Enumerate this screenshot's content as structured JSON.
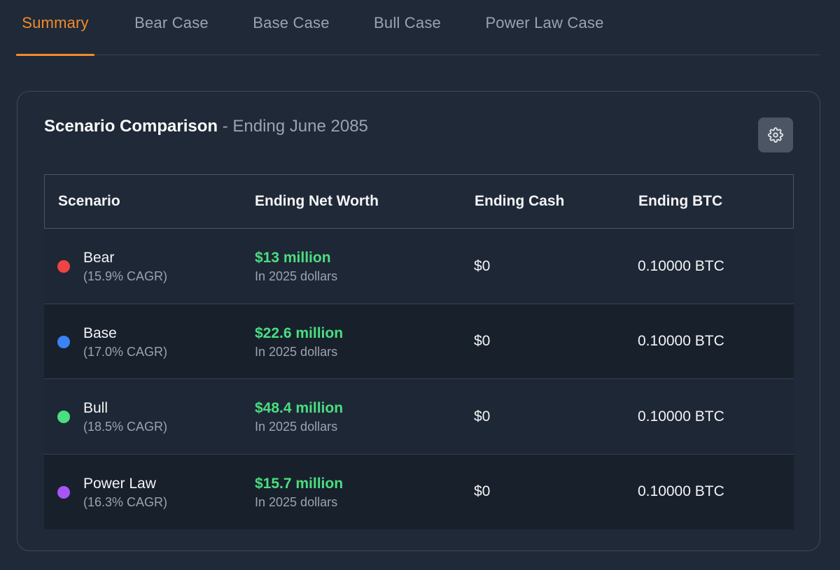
{
  "tabs": [
    {
      "label": "Summary",
      "active": true
    },
    {
      "label": "Bear Case",
      "active": false
    },
    {
      "label": "Base Case",
      "active": false
    },
    {
      "label": "Bull Case",
      "active": false
    },
    {
      "label": "Power Law Case",
      "active": false
    }
  ],
  "card": {
    "title": "Scenario Comparison",
    "separator": " - ",
    "subtitle": "Ending June 2085",
    "settings_icon": "gear-icon"
  },
  "table": {
    "headers": {
      "scenario": "Scenario",
      "net_worth": "Ending Net Worth",
      "cash": "Ending Cash",
      "btc": "Ending BTC"
    },
    "rows": [
      {
        "name": "Bear",
        "cagr": "(15.9% CAGR)",
        "color": "#ef4444",
        "net_worth": "$13 million",
        "net_worth_note": "In 2025 dollars",
        "cash": "$0",
        "btc": "0.10000 BTC"
      },
      {
        "name": "Base",
        "cagr": "(17.0% CAGR)",
        "color": "#3b82f6",
        "net_worth": "$22.6 million",
        "net_worth_note": "In 2025 dollars",
        "cash": "$0",
        "btc": "0.10000 BTC"
      },
      {
        "name": "Bull",
        "cagr": "(18.5% CAGR)",
        "color": "#4ade80",
        "net_worth": "$48.4 million",
        "net_worth_note": "In 2025 dollars",
        "cash": "$0",
        "btc": "0.10000 BTC"
      },
      {
        "name": "Power Law",
        "cagr": "(16.3% CAGR)",
        "color": "#a855f7",
        "net_worth": "$15.7 million",
        "net_worth_note": "In 2025 dollars",
        "cash": "$0",
        "btc": "0.10000 BTC"
      }
    ]
  },
  "colors": {
    "accent": "#f28b2e",
    "positive": "#4ade80",
    "background": "#1f2937"
  }
}
